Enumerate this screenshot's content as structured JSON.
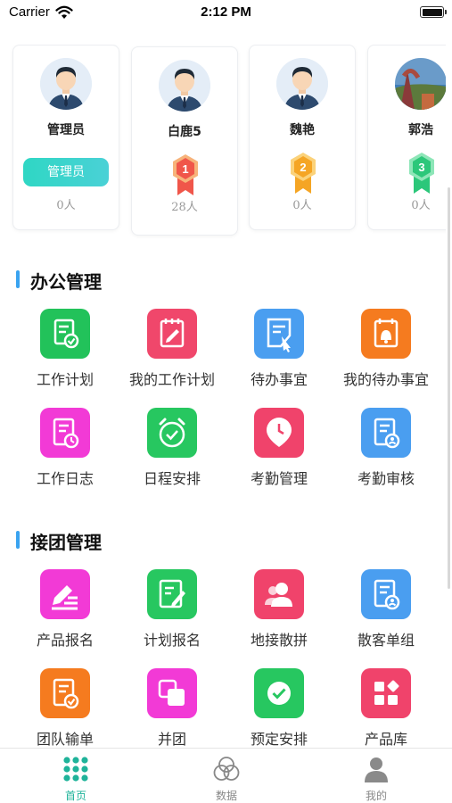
{
  "status_bar": {
    "carrier": "Carrier",
    "time": "2:12 PM"
  },
  "users": [
    {
      "name": "管理员",
      "role": "管理员",
      "count": "0人",
      "rank": null
    },
    {
      "name": "白鹿5",
      "role": null,
      "count": "28人",
      "rank": "1"
    },
    {
      "name": "魏艳",
      "role": null,
      "count": "0人",
      "rank": "2"
    },
    {
      "name": "郭浩",
      "role": null,
      "count": "0人",
      "rank": "3"
    }
  ],
  "sections": [
    {
      "title": "办公管理",
      "items": [
        {
          "label": "工作计划",
          "icon": "plan-icon",
          "color": "#22c25a"
        },
        {
          "label": "我的工作计划",
          "icon": "my-plan-icon",
          "color": "#f0476b"
        },
        {
          "label": "待办事宜",
          "icon": "todo-icon",
          "color": "#4a9ef0"
        },
        {
          "label": "我的待办事宜",
          "icon": "my-todo-icon",
          "color": "#f57b1f"
        },
        {
          "label": "工作日志",
          "icon": "work-log-icon",
          "color": "#f23ad6"
        },
        {
          "label": "日程安排",
          "icon": "alarm-clock-icon",
          "color": "#27c760"
        },
        {
          "label": "考勤管理",
          "icon": "clock-pin-icon",
          "color": "#f0436b"
        },
        {
          "label": "考勤审核",
          "icon": "attendance-review-icon",
          "color": "#4a9ef0"
        }
      ]
    },
    {
      "title": "接团管理",
      "items": [
        {
          "label": "产品报名",
          "icon": "pen-list-icon",
          "color": "#f23ad6"
        },
        {
          "label": "计划报名",
          "icon": "edit-doc-icon",
          "color": "#27c760"
        },
        {
          "label": "地接散拼",
          "icon": "users-icon",
          "color": "#f0436b"
        },
        {
          "label": "散客单组",
          "icon": "user-doc-icon",
          "color": "#4a9ef0"
        },
        {
          "label": "团队输单",
          "icon": "check-doc-icon",
          "color": "#f57b1f"
        },
        {
          "label": "并团",
          "icon": "merge-icon",
          "color": "#f23ad6"
        },
        {
          "label": "预定安排",
          "icon": "check-circle-icon",
          "color": "#27c760"
        },
        {
          "label": "产品库",
          "icon": "apps-icon",
          "color": "#f0436b"
        }
      ]
    }
  ],
  "tabs": [
    {
      "label": "首页",
      "icon": "grid-dots-icon",
      "active": true
    },
    {
      "label": "数据",
      "icon": "circles-icon",
      "active": false
    },
    {
      "label": "我的",
      "icon": "person-icon",
      "active": false
    }
  ],
  "colors": {
    "accent": "#1fb39a",
    "section_bar": "#3aa3f0",
    "role_badge": "#2fd7c4"
  }
}
